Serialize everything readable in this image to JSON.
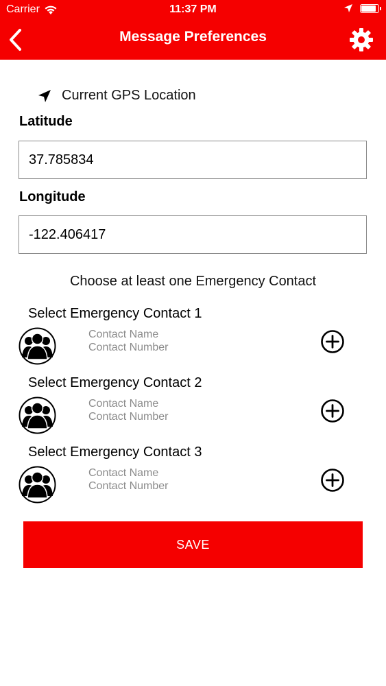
{
  "status_bar": {
    "carrier": "Carrier",
    "time": "11:37 PM"
  },
  "nav": {
    "title": "Message Preferences"
  },
  "gps": {
    "label": "Current GPS Location"
  },
  "latitude": {
    "label": "Latitude",
    "value": "37.785834"
  },
  "longitude": {
    "label": "Longitude",
    "value": "-122.406417"
  },
  "contacts": {
    "instruction": "Choose at least one Emergency Contact",
    "items": [
      {
        "title": "Select Emergency Contact 1",
        "name_placeholder": "Contact Name",
        "number_placeholder": "Contact Number"
      },
      {
        "title": "Select Emergency Contact 2",
        "name_placeholder": "Contact Name",
        "number_placeholder": "Contact Number"
      },
      {
        "title": "Select Emergency Contact 3",
        "name_placeholder": "Contact Name",
        "number_placeholder": "Contact Number"
      }
    ]
  },
  "save": {
    "label": "SAVE"
  },
  "colors": {
    "brand_red": "#f50000",
    "input_border": "#888888",
    "placeholder_gray": "#8a8a8a"
  },
  "icons": {
    "wifi": "wifi-icon",
    "location_arrow": "location-arrow-icon",
    "battery": "battery-icon",
    "back": "chevron-left-icon",
    "settings": "gear-icon",
    "gps": "navigation-arrow-icon",
    "contact_avatar": "group-avatar-icon",
    "add": "plus-circle-icon"
  }
}
